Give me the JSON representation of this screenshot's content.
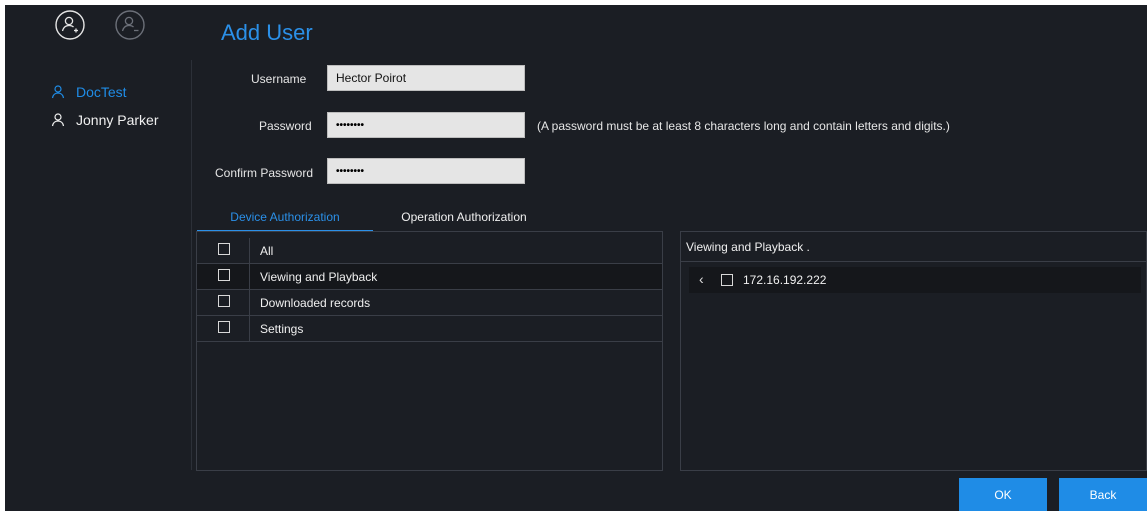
{
  "sidebar": {
    "add_user_icon": "user-add-icon",
    "remove_user_icon": "user-remove-icon",
    "users": [
      {
        "name": "DocTest",
        "active": true
      },
      {
        "name": "Jonny Parker",
        "active": false
      }
    ]
  },
  "page_title": "Add User",
  "form": {
    "username_label": "Username",
    "username_value": "Hector Poirot",
    "password_label": "Password",
    "password_value": "••••••••",
    "password_hint": "(A password must be at least 8 characters long and contain letters and digits.)",
    "confirm_label": "Confirm Password",
    "confirm_value": "••••••••"
  },
  "tabs": [
    {
      "label": "Device Authorization",
      "active": true
    },
    {
      "label": "Operation Authorization",
      "active": false
    }
  ],
  "permissions": [
    {
      "label": "All",
      "checked": false
    },
    {
      "label": "Viewing and Playback",
      "checked": false,
      "selected": true
    },
    {
      "label": "Downloaded records",
      "checked": false
    },
    {
      "label": "Settings",
      "checked": false
    }
  ],
  "device_panel": {
    "header": "Viewing and Playback .",
    "devices": [
      {
        "ip": "172.16.192.222",
        "checked": false
      }
    ]
  },
  "buttons": {
    "ok": "OK",
    "back": "Back"
  },
  "colors": {
    "accent": "#1f8ce6",
    "background": "#1b1e24",
    "selected_row": "#15171b"
  }
}
